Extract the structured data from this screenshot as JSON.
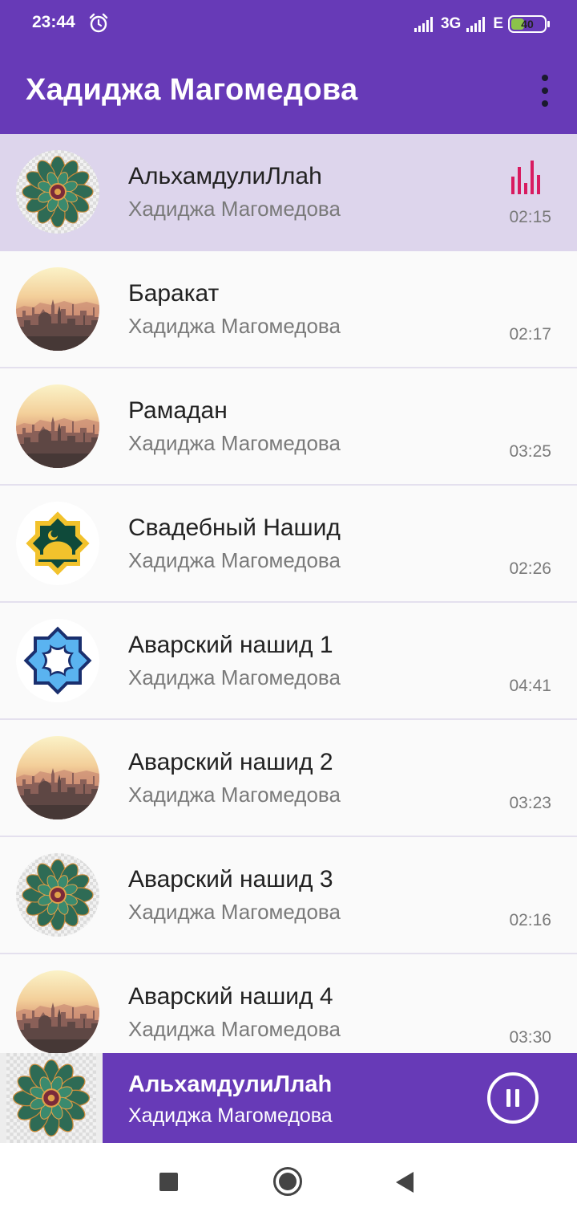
{
  "status_bar": {
    "time": "23:44",
    "network_1": "3G",
    "network_2": "E",
    "battery": "40",
    "battery_level": 0.4
  },
  "app_bar": {
    "title": "Хадиджа Магомедова",
    "menu_icon": "more-vert-icon"
  },
  "tracks": [
    {
      "title": "АльхамдулиЛлаh",
      "artist": "Хадиджа Магомедова",
      "duration": "02:15",
      "art": "mandala",
      "playing": true
    },
    {
      "title": "Баракат",
      "artist": "Хадиджа Магомедова",
      "duration": "02:17",
      "art": "city-skyline"
    },
    {
      "title": "Рамадан",
      "artist": "Хадиджа Магомедова",
      "duration": "03:25",
      "art": "city-skyline"
    },
    {
      "title": "Свадебный Нашид",
      "artist": "Хадиджа Магомедова",
      "duration": "02:26",
      "art": "mosque-star"
    },
    {
      "title": "Аварский нашид 1",
      "artist": "Хадиджа Магомедова",
      "duration": "04:41",
      "art": "blue-star"
    },
    {
      "title": "Аварский нашид 2",
      "artist": "Хадиджа Магомедова",
      "duration": "03:23",
      "art": "city-skyline"
    },
    {
      "title": "Аварский нашид 3",
      "artist": "Хадиджа Магомедова",
      "duration": "02:16",
      "art": "mandala"
    },
    {
      "title": "Аварский нашид 4",
      "artist": "Хадиджа Магомедова",
      "duration": "03:30",
      "art": "city-skyline"
    }
  ],
  "mini_player": {
    "title": "АльхамдулиЛлаh",
    "artist": "Хадиджа Магомедова",
    "art": "mandala",
    "control_icon": "pause-icon"
  },
  "system_nav": {
    "icons": [
      "recents-icon",
      "home-icon",
      "back-icon"
    ]
  },
  "colors": {
    "primary": "#673ab7",
    "active_row": "#ddd5ec",
    "equalizer": "#d81b60"
  }
}
